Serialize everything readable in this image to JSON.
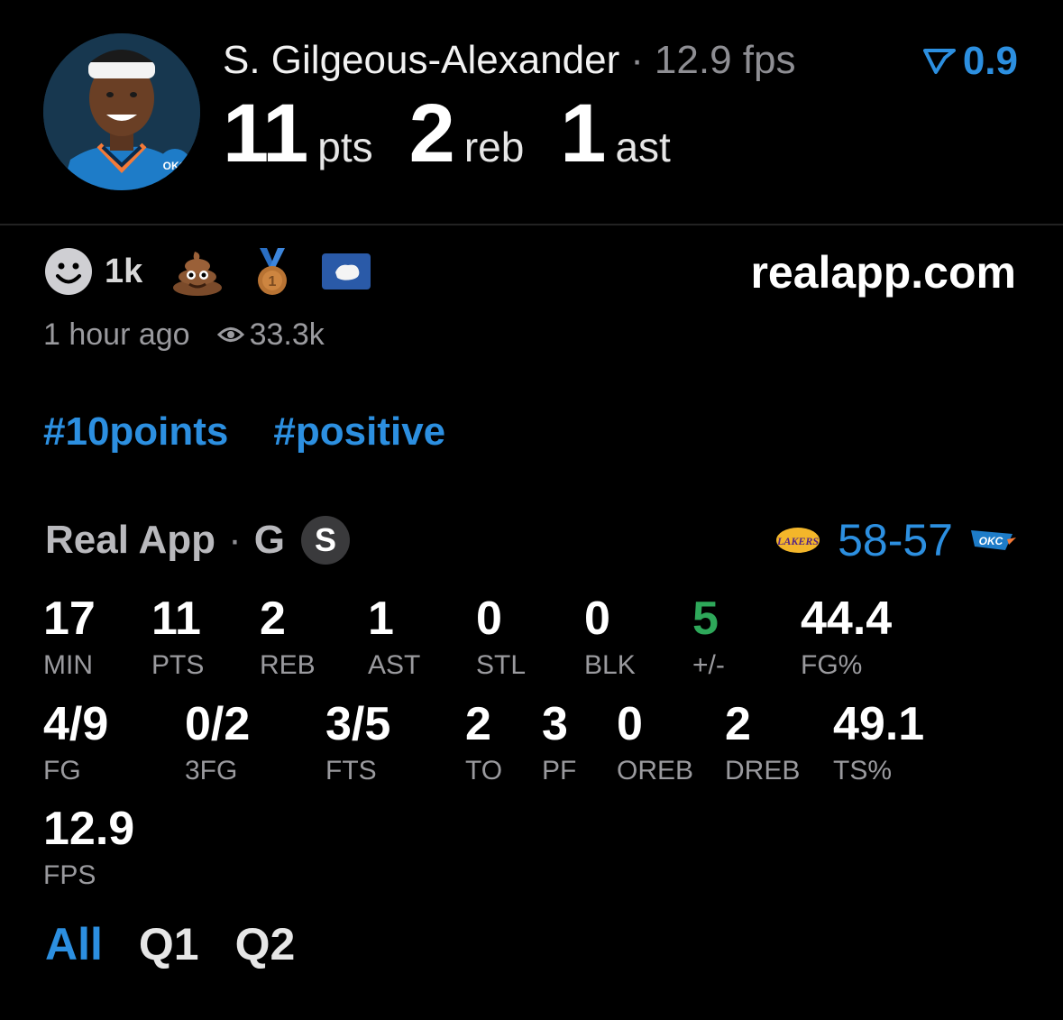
{
  "header": {
    "player_name": "S. Gilgeous-Alexander",
    "separator": "·",
    "fps_text": "12.9 fps",
    "vote_value": "0.9",
    "points_value": "11",
    "points_label": "pts",
    "rebounds_value": "2",
    "rebounds_label": "reb",
    "assists_value": "1",
    "assists_label": "ast"
  },
  "reactions": {
    "smile_count": "1k",
    "icons": [
      "smile-icon",
      "poop-emoji-icon",
      "bronze-medal-icon",
      "flag-icon"
    ]
  },
  "site": "realapp.com",
  "meta": {
    "time_ago": "1 hour ago",
    "views": "33.3k"
  },
  "tags": [
    "#10points",
    "#positive"
  ],
  "source": {
    "app_name": "Real App",
    "separator": "·",
    "position": "G",
    "badge": "S"
  },
  "score": {
    "home": "58",
    "dash": "-",
    "away": "57"
  },
  "stats_row1": [
    {
      "value": "17",
      "label": "MIN"
    },
    {
      "value": "11",
      "label": "PTS"
    },
    {
      "value": "2",
      "label": "REB"
    },
    {
      "value": "1",
      "label": "AST"
    },
    {
      "value": "0",
      "label": "STL"
    },
    {
      "value": "0",
      "label": "BLK"
    },
    {
      "value": "5",
      "label": "+/-"
    },
    {
      "value": "44.4",
      "label": "FG%"
    }
  ],
  "stats_row2": [
    {
      "value": "4/9",
      "label": "FG"
    },
    {
      "value": "0/2",
      "label": "3FG"
    },
    {
      "value": "3/5",
      "label": "FTS"
    },
    {
      "value": "2",
      "label": "TO"
    },
    {
      "value": "3",
      "label": "PF"
    },
    {
      "value": "0",
      "label": "OREB"
    },
    {
      "value": "2",
      "label": "DREB"
    },
    {
      "value": "49.1",
      "label": "TS%"
    }
  ],
  "stats_row3": [
    {
      "value": "12.9",
      "label": "FPS"
    }
  ],
  "tabs": [
    "All",
    "Q1",
    "Q2"
  ],
  "colors": {
    "accent": "#2c8fe0",
    "positive": "#2ea85a",
    "background": "#000000"
  }
}
